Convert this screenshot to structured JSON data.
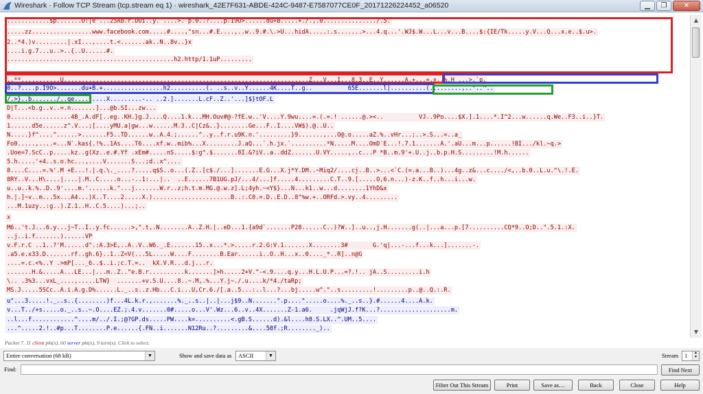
{
  "window": {
    "title": "Wireshark · Follow TCP Stream (tcp.stream eq 1) · wireshark_42E7F631-ABDE-424C-9487-E7587077CE0F_20171226224452_a06520",
    "minimize_glyph": "▁",
    "restore_glyph": "❐",
    "close_glyph": "✕"
  },
  "stream_lines": [
    "............$p.......O:|e ...25Ab.r.DOi..y. ....>.`p.0..?....p.I9O>......du+B.....+./.,.0.............../.5.",
    ".....zz.................www.facebook.com.....#....,\"sn...#.E....,..w..9.#.\\.>U...hidA.....:.s.......>...4.q...'.WJ$.W...L...v...B....$:{IE/Tk.....y.V...Q...x.e..$.u>.",
    "2..*4.)v.........|.xI...,....t.<.......ak..N..8v..}x",
    "....i.g.7...u..>..{..U......#.",
    "...............................................h2.http/1.1uP.........",
    "",
    "..**...........U.....................................................................Z...V...I...8.3..E..Y......A.+...=.x..%.H ...>.`p.",
    "0..?....p.I9O>.......du+B.+.................h2..........(. ..s..v..Y......4K....T..g..          65E.......l|..........(.........,..\"..^..",
    "/.>}..b......./..qe.........X.........-.. ..2.].......L.cF..Z..'...]$}tOF.L",
    "D|T...<b.g..v..=.n.......]...@b.SI...zw...",
    "0.................4B_.A.dF[..eg..KH.}g.J....Q....1.k...MH.Ouv#@-?fE.w..'V....Y.9wu....=.(.=.! ......@.><..          VJ..9Po....$X.].1....*.I^2...w......q.We..F3..i..}T.",
    "1......d5e......z^.V...;[....yMU.a|gw...w......M.3..C|Cz&..}........Ge...F..I....VW$).@..U..",
    "N.....}f^....^......>.......F5..TD......w..A.4.;......^..y..f.r.u9K.n.'.........}9.......,...O@.o.....aZ.%..vHr...;..>.S...=..a_",
    "Fo0.....,....=...N`.kas{.!%..1As....T6....xf.w..mib%...X.........J.aQ...`.h.jx.`..........*N.....M....OmD`E...!.7.1.......A.'.aU...m...p......!BI.../kl.~q.>",
    ".Uoe=7.ScC..p.....kz..g(Xz..e.#.Yf .xEm#.....nS.....$:g^.$.......8I.&?iV..a..ddZ.......U.VY.....,..c...P *B..m.9'+.U..j..b.p.H.S.........!M.h......",
    "5.h.....'+4..s.o.hc...,....V.......S...;d..x^....",
    "8....C....=.%'.M +E...!.|.q.\\._....?.....q$S..o...(.Z..[c$./...].......E.G...X.j*Y.DM..~Miq2/....cj..B..>...<`C.(=.a...B..)...4g..z&...c..../<,..b.0..L.u.^\\.!.E.",
    "8RY..V...H\\....|....|.M..C.....o...-..1:...|..  ..E......7B1UG.pJ/...4/...]f.....4.........C.T..9.[.....O,6.n...)-z.K..f..h...i...w.",
    "u..u..k.%..D..9'....m.'......k.\"...j.......W.r..z;h.t.m.MG.@.w.z].L;4yh.~<Y$}...N...k1..w...d........1YhD&x",
    "h.|.]~v..m...5x...A4...)X..T....2.....X.)......................B..:.C0.=.D..E.D..8\"%w.+..ORFd.>.vy..4.........",
    "...M.1uzy..:g..).Z.1..H..C.5....)...;..",
    "x",
    "M6..'t.J...6.y...j~T..I..y.fc......>,\".t,.N........A..Z.H.|..eD...1.{a9d`.......P28......C..)?W..]..u..,j.H.......g(..|...a...p.[7..........CQ*9..O;D..\".5.1.:X.",
    "..j..i.f.......)......VP",
    "v.F.r.C ..1..?'M......d\".:A.3>E,..A..V..W6._.E.......15..x...*.>.....r.2.G:V.1.......X........3#       G.'q|...-...f...k...].......-.",
    ".a5.e.x33.D.......rf..gh.6}..1..Z<V(...5L.....W....F........B.Ear......i..O..H...x..0...._*..R]..n@G",
    "....=.c.<%..Y .>mP[..._6..$..i.;c.T.=..  kX.V.R...d.j...r.",
    ".......H.&.....A...LE...|...m..Z..\"e.B.r..........k.......]>h.....2+V.\"-<.9....q.y...H.L.U.P...=?.!.. jA..S.........i.h",
    "\\.. .3%3...vxL_....,.....LTW}  .......+v.S.U....8..~.M,.%...Y.j~./.u....k/*4./taRp;",
    "MS.J.....5SCc..A.i.A.g.D%......L._..s..z.Hb...C.i...U,Cr.6./[.a..5...:..l...?...bj.....w^.\"..s.........!.........p..@..Q.:.R.",
    "u\"...3.....!._..s..{........)f...4L.k.r.,.......%._..s..|..|...j$9..N.......\".p....\".....o....%._..s..}.#......4....A.k.",
    "v...T../+s.....o._..s..~.O....EZ.;.4.v.......0#.....o...V'.Wz...6..v..4X.......Z-1.a6.     .jqWjJ.f?K...?....................m.",
    "..l...f............^....m/../.I.;@?GP.ds.....PW....k=..........<.gB.S......d).&l....h8.S.LX..^.UM..5....",
    "...^.....2.!..#p...T........P.e......{.FN..i.......N12Ru..?.........&....58f.;R........_).."
  ],
  "summary": {
    "prefix": "Packet 7. 11 ",
    "client_label": "client",
    "mid": " pkt(s), 60 ",
    "server_label": "server",
    "suffix": " pkt(s), 9 turn(s). Click to select."
  },
  "controls": {
    "conversation_value": "Entire conversation (68 kB)",
    "show_save_label": "Show and save data as",
    "format_value": "ASCII",
    "stream_label": "Stream",
    "stream_value": "1"
  },
  "find": {
    "label": "Find:",
    "value": "",
    "find_next_label": "Find Next"
  },
  "buttons": {
    "filter_out": "Filter Out This Stream",
    "print": "Print",
    "save_as": "Save as…",
    "back": "Back",
    "close": "Close",
    "help": "Help"
  }
}
